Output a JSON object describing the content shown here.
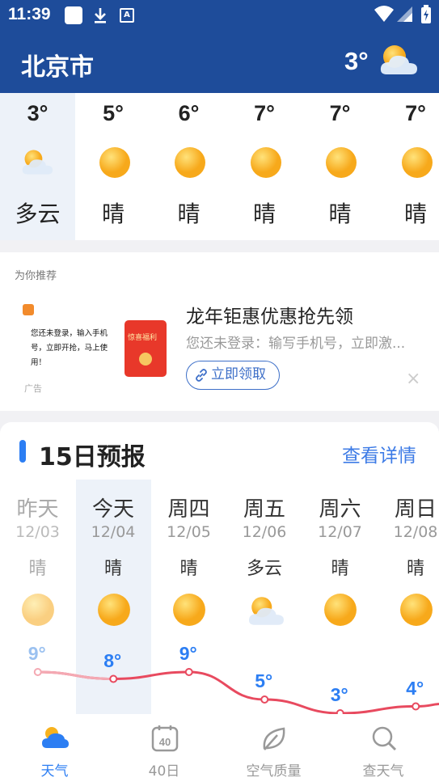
{
  "status_bar": {
    "time": "11:39"
  },
  "header": {
    "city": "北京市",
    "current_temp": "3°",
    "current_icon": "cloudy-sun-icon"
  },
  "hourly": [
    {
      "temp": "3°",
      "desc": "多云",
      "icon": "cloudy-sun-icon"
    },
    {
      "temp": "5°",
      "desc": "晴",
      "icon": "sun-icon"
    },
    {
      "temp": "6°",
      "desc": "晴",
      "icon": "sun-icon"
    },
    {
      "temp": "7°",
      "desc": "晴",
      "icon": "sun-icon"
    },
    {
      "temp": "7°",
      "desc": "晴",
      "icon": "sun-icon"
    },
    {
      "temp": "7°",
      "desc": "晴",
      "icon": "sun-icon"
    }
  ],
  "ad": {
    "section_label": "为你推荐",
    "thumb_text": "您还未登录，输入手机号，立即开抢，马上使用！",
    "envelope_caption": "惊喜福利",
    "ad_tag": "广告",
    "title": "龙年钜惠优惠抢先领",
    "subtitle": "您还未登录：输写手机号，立即激...",
    "cta": "立即领取",
    "close": "×"
  },
  "forecast": {
    "title": "15日预报",
    "more": "查看详情",
    "days": [
      {
        "weekday": "昨天",
        "date": "12/03",
        "cond": "晴",
        "high": "9°",
        "high_value": 9
      },
      {
        "weekday": "今天",
        "date": "12/04",
        "cond": "晴",
        "high": "8°",
        "high_value": 8
      },
      {
        "weekday": "周四",
        "date": "12/05",
        "cond": "晴",
        "high": "9°",
        "high_value": 9
      },
      {
        "weekday": "周五",
        "date": "12/06",
        "cond": "多云",
        "high": "5°",
        "high_value": 5
      },
      {
        "weekday": "周六",
        "date": "12/07",
        "cond": "晴",
        "high": "3°",
        "high_value": 3
      },
      {
        "weekday": "周日",
        "date": "12/08",
        "cond": "晴",
        "high": "4°",
        "high_value": 4
      }
    ]
  },
  "nav": [
    {
      "label": "天气",
      "icon": "weather-icon",
      "active": true
    },
    {
      "label": "40日",
      "icon": "calendar-40-icon",
      "active": false
    },
    {
      "label": "空气质量",
      "icon": "leaf-icon",
      "active": false
    },
    {
      "label": "查天气",
      "icon": "search-icon",
      "active": false
    }
  ],
  "colors": {
    "header_bg": "#1e4c9a",
    "accent": "#2c7ef3",
    "curve": "#e84a5f",
    "sun": "#f7b21e"
  }
}
